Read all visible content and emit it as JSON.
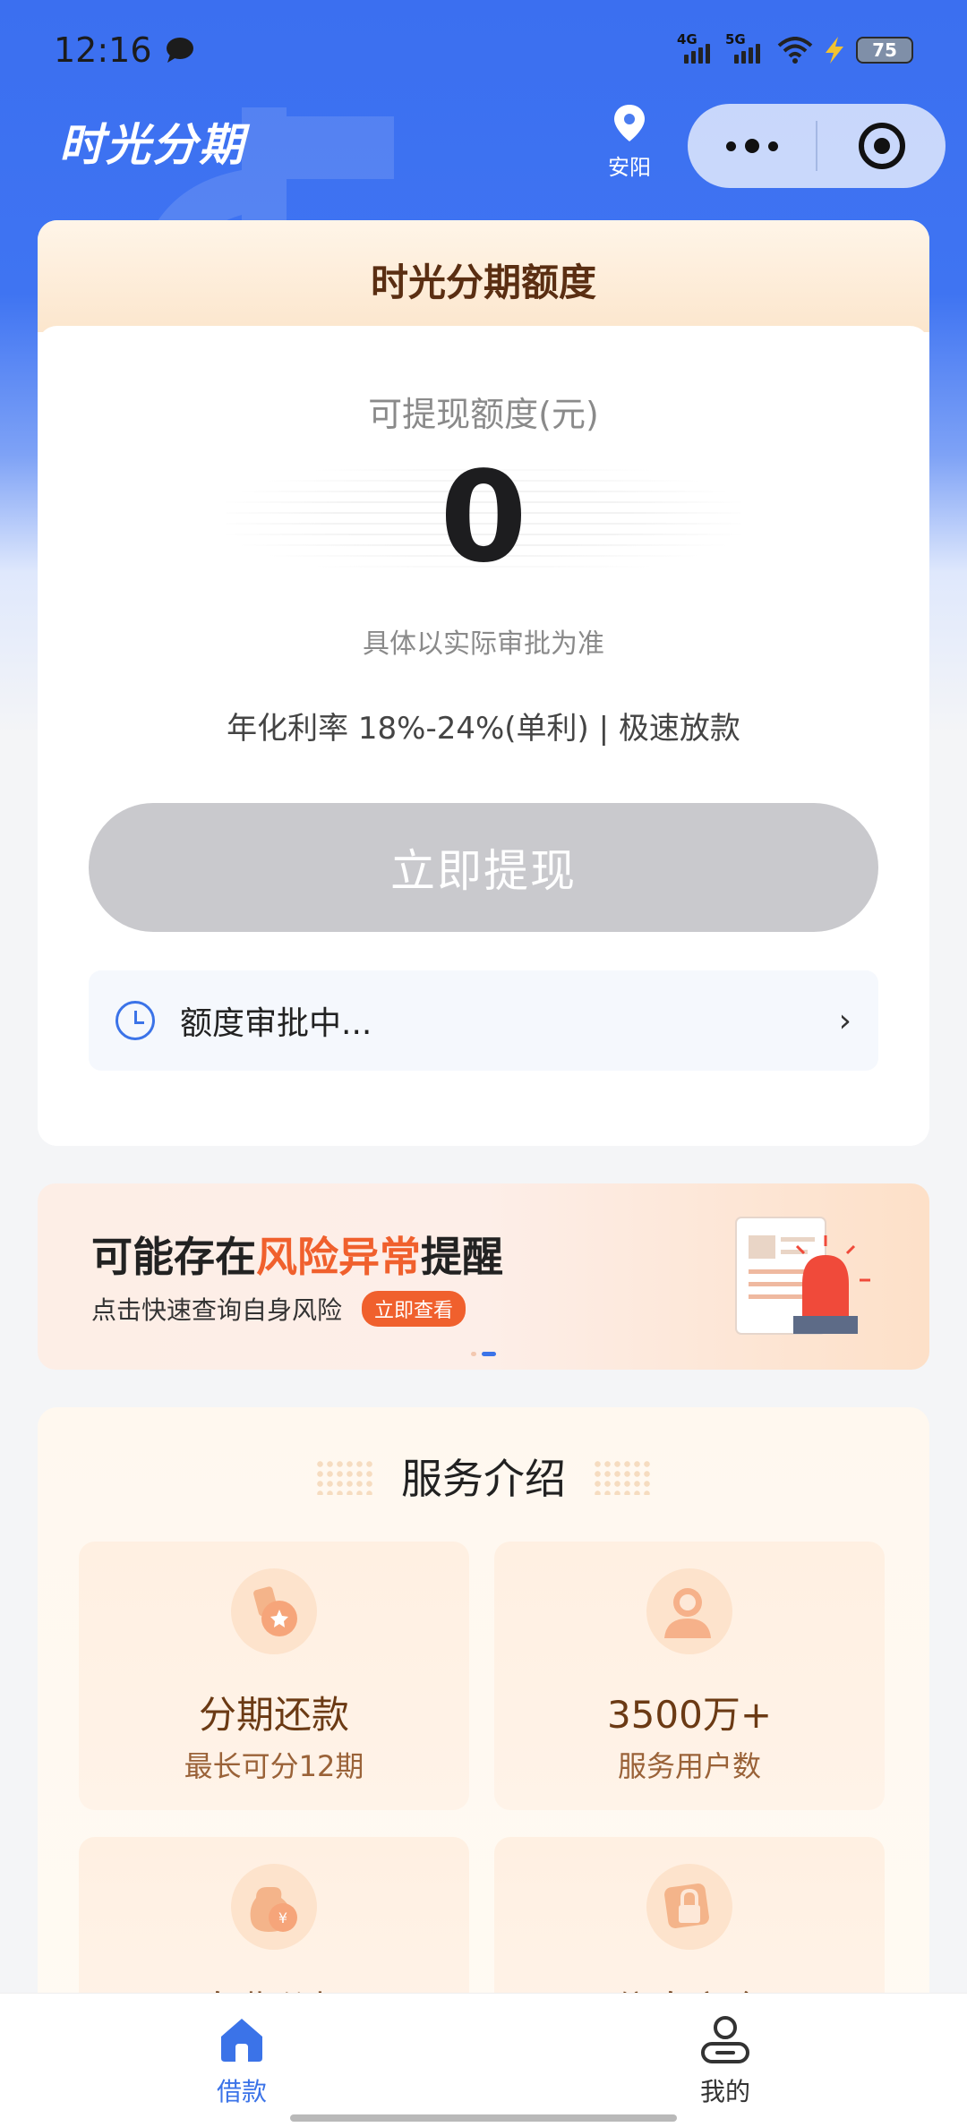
{
  "status_bar": {
    "time": "12:16",
    "network1": "4G",
    "network2": "5G",
    "battery": "75"
  },
  "header": {
    "app_title": "时光分期",
    "location": "安阳"
  },
  "quota": {
    "title": "时光分期额度",
    "available_label": "可提现额度(元)",
    "amount": "0",
    "note": "具体以实际审批为准",
    "rate_text": "年化利率 18%-24%(单利) | 极速放款",
    "withdraw_button": "立即提现",
    "approval_status": "额度审批中..."
  },
  "risk_banner": {
    "title_prefix": "可能存在",
    "title_highlight": "风险异常",
    "title_suffix": "提醒",
    "subtitle": "点击快速查询自身风险",
    "button": "立即查看",
    "highlight_color": "#f0602d"
  },
  "services": {
    "title": "服务介绍",
    "items": [
      {
        "main": "分期还款",
        "sub": "最长可分12期",
        "icon": "medal-icon"
      },
      {
        "main": "3500万+",
        "sub": "服务用户数",
        "icon": "user-icon"
      },
      {
        "main": "息费分担",
        "sub": "",
        "icon": "money-bag-icon"
      },
      {
        "main": "信息安全",
        "sub": "",
        "icon": "lock-icon"
      }
    ]
  },
  "tabbar": {
    "items": [
      {
        "label": "借款",
        "icon": "home-icon",
        "active": true
      },
      {
        "label": "我的",
        "icon": "profile-icon",
        "active": false
      }
    ]
  },
  "colors": {
    "primary": "#3b73e8",
    "accent": "#f0602d"
  }
}
